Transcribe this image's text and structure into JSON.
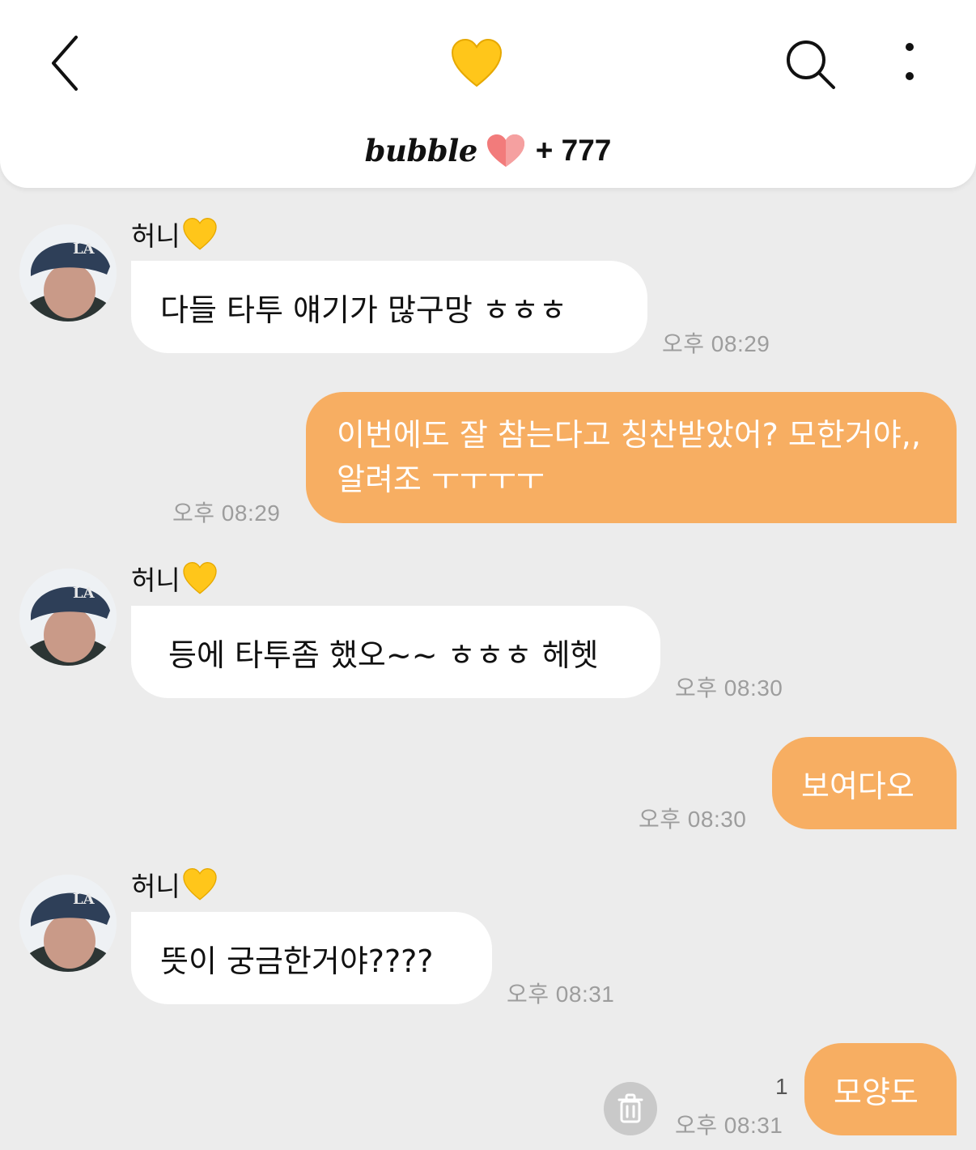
{
  "header": {
    "back_icon": "chevron-left-icon",
    "heart_icon": "yellow-heart-icon",
    "search_icon": "search-icon",
    "more_icon": "more-vertical-icon",
    "brand_name": "bubble",
    "brand_heart_icon": "pink-heart-icon",
    "member_count": "+ 777"
  },
  "colors": {
    "background": "#ececec",
    "incoming_bubble": "#ffffff",
    "outgoing_bubble": "#f7ae62",
    "timestamp": "#9d9d9d",
    "heart_yellow": "#ffc61a",
    "heart_pink": "#f27b7b"
  },
  "messages": [
    {
      "direction": "incoming",
      "sender": "허니",
      "text": "다들 타투 얘기가 많구망 ㅎㅎㅎ",
      "time": "오후 08:29"
    },
    {
      "direction": "outgoing",
      "text": "이번에도 잘 참는다고 칭찬받았어? 모한거야,, 알려조 ㅜㅜㅜㅜ",
      "time": "오후 08:29"
    },
    {
      "direction": "incoming",
      "sender": "허니",
      "text": "등에 타투좀 했오~~ ㅎㅎㅎ 헤헷",
      "time": "오후 08:30"
    },
    {
      "direction": "outgoing",
      "text": "보여다오",
      "time": "오후 08:30"
    },
    {
      "direction": "incoming",
      "sender": "허니",
      "text": "뜻이 궁금한거야????",
      "time": "오후 08:31"
    },
    {
      "direction": "outgoing",
      "text": "모양도",
      "time": "오후 08:31",
      "unread": "1",
      "delete_icon": "trash-icon"
    }
  ]
}
